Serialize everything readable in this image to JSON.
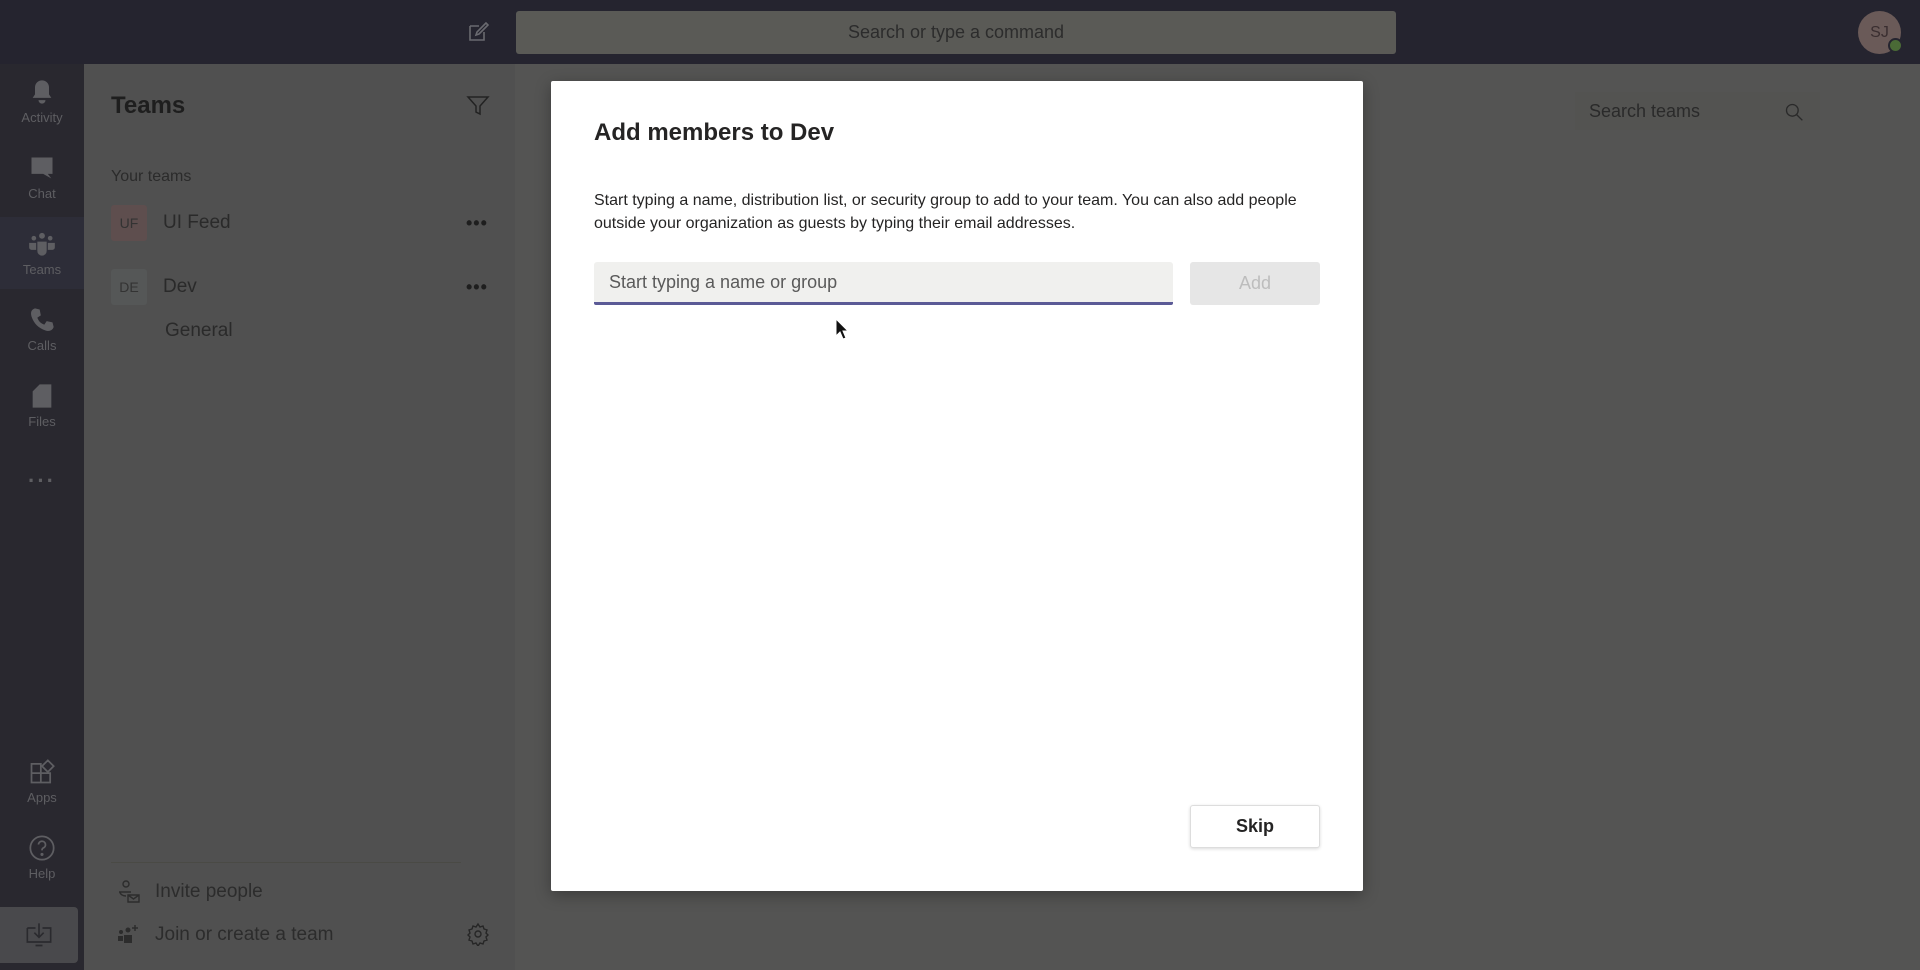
{
  "topbar": {
    "search_placeholder": "Search or type a command",
    "avatar_initials": "SJ",
    "presence": "available",
    "icons": [
      "compose-icon"
    ]
  },
  "rail": {
    "items": [
      {
        "label": "Activity",
        "icon": "bell-icon"
      },
      {
        "label": "Chat",
        "icon": "chat-icon"
      },
      {
        "label": "Teams",
        "icon": "teams-icon",
        "active": true
      },
      {
        "label": "Calls",
        "icon": "phone-icon"
      },
      {
        "label": "Files",
        "icon": "file-icon"
      },
      {
        "label": "",
        "icon": "more-icon"
      },
      {
        "label": "Apps",
        "icon": "apps-icon"
      },
      {
        "label": "Help",
        "icon": "help-icon"
      }
    ],
    "download_icon": "download-icon"
  },
  "panel": {
    "title": "Teams",
    "section": "Your teams",
    "teams": [
      {
        "initials": "UF",
        "name": "UI Feed",
        "color": "#5e4e4e"
      },
      {
        "initials": "DE",
        "name": "Dev",
        "color": "#555757"
      }
    ],
    "channel": "General",
    "invite": "Invite people",
    "join": "Join or create a team"
  },
  "main": {
    "search_teams_placeholder": "Search teams"
  },
  "modal": {
    "title": "Add members to Dev",
    "description": "Start typing a name, distribution list, or security group to add to your team. You can also add people outside your organization as guests by typing their email addresses.",
    "input_placeholder": "Start typing a name or group",
    "input_value": "",
    "add_label": "Add",
    "skip_label": "Skip",
    "accent": "#6264a7"
  }
}
